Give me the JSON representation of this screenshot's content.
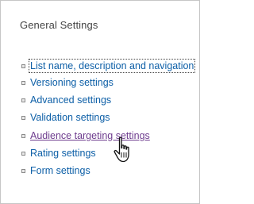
{
  "section": {
    "title": "General Settings"
  },
  "links": [
    {
      "label": "List name, description and navigation"
    },
    {
      "label": "Versioning settings"
    },
    {
      "label": "Advanced settings"
    },
    {
      "label": "Validation settings"
    },
    {
      "label": "Audience targeting settings"
    },
    {
      "label": "Rating settings"
    },
    {
      "label": "Form settings"
    }
  ],
  "colors": {
    "link": "#0d5fa7",
    "visited_link": "#6e3c8e",
    "title": "#444444"
  },
  "icons": {
    "bullet": "square-bullet-icon",
    "cursor": "hand-pointer-icon"
  }
}
